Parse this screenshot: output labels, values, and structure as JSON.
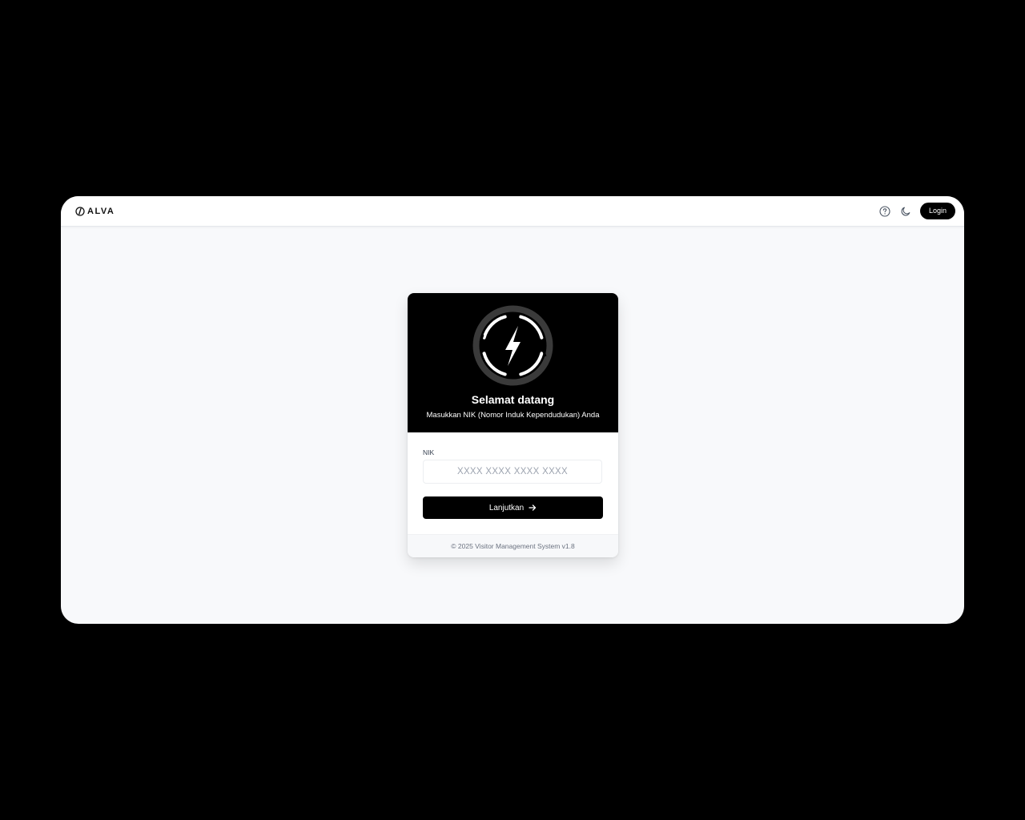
{
  "header": {
    "logo_text": "ALVA",
    "help_icon": "help-circle-icon",
    "theme_icon": "moon-icon",
    "login_label": "Login"
  },
  "card": {
    "emblem_icon": "lightning-bolt-icon",
    "title": "Selamat datang",
    "subtitle": "Masukkan NIK (Nomor Induk Kependudukan) Anda",
    "nik_label": "NIK",
    "nik_value": "",
    "nik_placeholder": "XXXX XXXX XXXX XXXX",
    "continue_label": "Lanjutkan",
    "continue_icon": "arrow-right-icon",
    "footer": "© 2025 Visitor Management System v1.8"
  },
  "colors": {
    "page_background": "#000000",
    "app_background": "#f8f9fb",
    "primary": "#000000",
    "on_primary": "#ffffff"
  }
}
